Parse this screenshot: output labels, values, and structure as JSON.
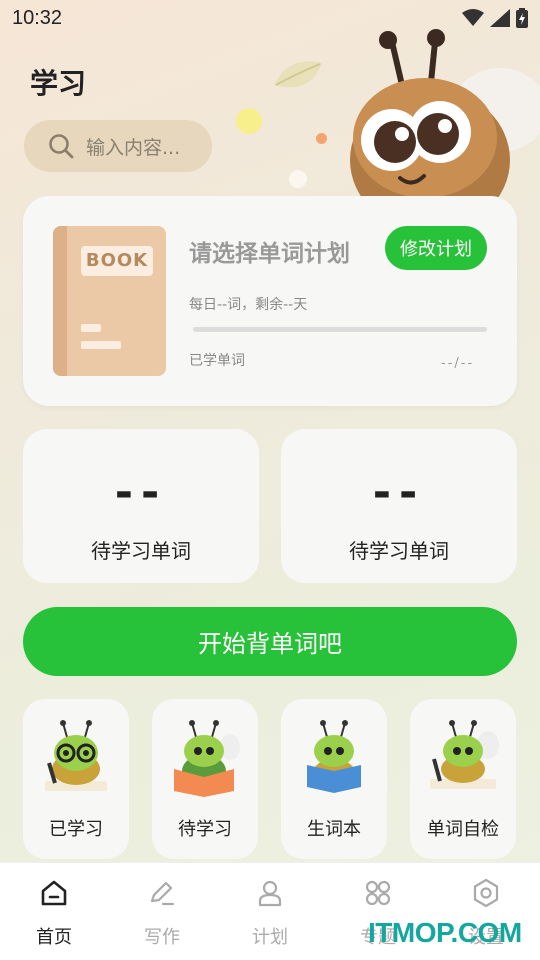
{
  "status_bar": {
    "time": "10:32"
  },
  "header": {
    "title": "学习"
  },
  "search": {
    "placeholder": "输入内容..."
  },
  "plan": {
    "book_label": "BOOK",
    "title": "请选择单词计划",
    "modify_label": "修改计划",
    "daily_text": "每日--词，剩余--天",
    "learned_label": "已学单词",
    "learned_count": "--/--",
    "progress": 0
  },
  "stats": [
    {
      "value": "--",
      "label": "待学习单词"
    },
    {
      "value": "--",
      "label": "待学习单词"
    }
  ],
  "start_button": {
    "label": "开始背单词吧"
  },
  "quick_actions": [
    {
      "label": "已学习",
      "icon": "bee-glasses-icon"
    },
    {
      "label": "待学习",
      "icon": "bee-reading-icon"
    },
    {
      "label": "生词本",
      "icon": "bee-book-icon"
    },
    {
      "label": "单词自检",
      "icon": "bee-writing-icon"
    }
  ],
  "tabs": [
    {
      "label": "首页",
      "icon": "home-icon",
      "active": true
    },
    {
      "label": "写作",
      "icon": "pen-icon",
      "active": false
    },
    {
      "label": "计划",
      "icon": "user-icon",
      "active": false
    },
    {
      "label": "专题",
      "icon": "grid-icon",
      "active": false
    },
    {
      "label": "设置",
      "icon": "gear-icon",
      "active": false
    }
  ],
  "watermark": "ITMOP.COM",
  "colors": {
    "accent": "#27c13a",
    "card": "#f7f7f5",
    "inactive": "#aaaaaa"
  }
}
